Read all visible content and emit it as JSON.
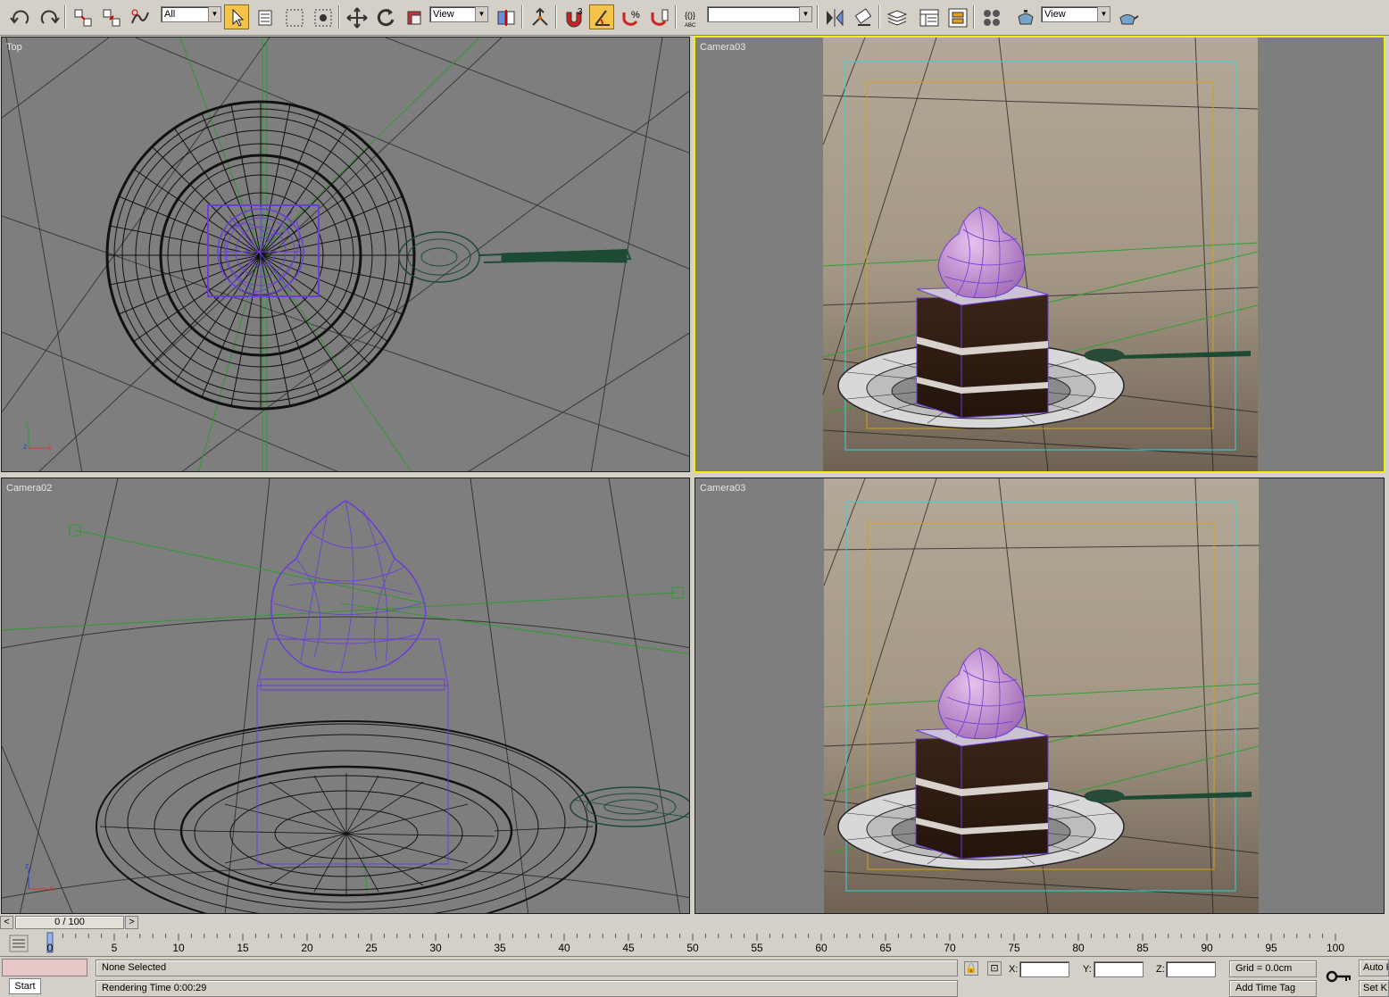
{
  "toolbar": {
    "selection_filter": "All",
    "ref_coord_system": "View",
    "named_selection_sets": "",
    "render_view": "View",
    "snap_3d_badge": "3",
    "angle_snap_badge": "",
    "percent_snap_badge": "%"
  },
  "viewports": {
    "top_left": {
      "label": "Top"
    },
    "top_right": {
      "label": "Camera03"
    },
    "bottom_left": {
      "label": "Camera02"
    },
    "bottom_right": {
      "label": "Camera03"
    }
  },
  "time_slider": {
    "frame_display": "0 / 100",
    "prev_label": "<",
    "next_label": ">"
  },
  "track_bar": {
    "tick_labels": [
      "0",
      "5",
      "10",
      "15",
      "20",
      "25",
      "30",
      "35",
      "40",
      "45",
      "50",
      "55",
      "60",
      "65",
      "70",
      "75",
      "80",
      "85",
      "90",
      "95",
      "100"
    ]
  },
  "status_bar": {
    "start_button": "Start",
    "selection_status": "None Selected",
    "render_time": "Rendering Time  0:00:29",
    "x_label": "X:",
    "y_label": "Y:",
    "z_label": "Z:",
    "x_value": "",
    "y_value": "",
    "z_value": "",
    "grid": "Grid = 0.0cm",
    "add_time_tag": "Add Time Tag",
    "auto_key": "Auto K",
    "set_key": "Set K"
  },
  "colors": {
    "ui_gray": "#d4d0c8",
    "viewport_bg": "#7e7e7e",
    "active_viewport_border": "#f0f000",
    "wire_black": "#111111",
    "wire_purple": "#6a3cd8",
    "wire_green": "#2f9a2f",
    "spoon_green": "#1d4a33",
    "safe_frame_cyan": "#2fd6d6",
    "safe_frame_orange": "#d4a017",
    "active_tool": "#f3c34a"
  },
  "icons": [
    "undo-icon",
    "redo-icon",
    "select-and-link-icon",
    "unlink-selection-icon",
    "bind-space-warp-icon",
    "select-object-icon",
    "select-by-name-icon",
    "rectangular-selection-region-icon",
    "window-crossing-icon",
    "select-and-move-icon",
    "select-and-rotate-icon",
    "select-and-scale-icon",
    "use-pivot-center-icon",
    "select-and-manipulate-icon",
    "snaps-toggle-icon",
    "angle-snap-toggle-icon",
    "percent-snap-icon",
    "spinner-snap-icon",
    "edit-named-selection-icon",
    "mirror-icon",
    "align-icon",
    "layer-manager-icon",
    "curve-editor-icon",
    "schematic-view-icon",
    "material-editor-icon",
    "render-setup-icon",
    "quick-render-icon"
  ]
}
